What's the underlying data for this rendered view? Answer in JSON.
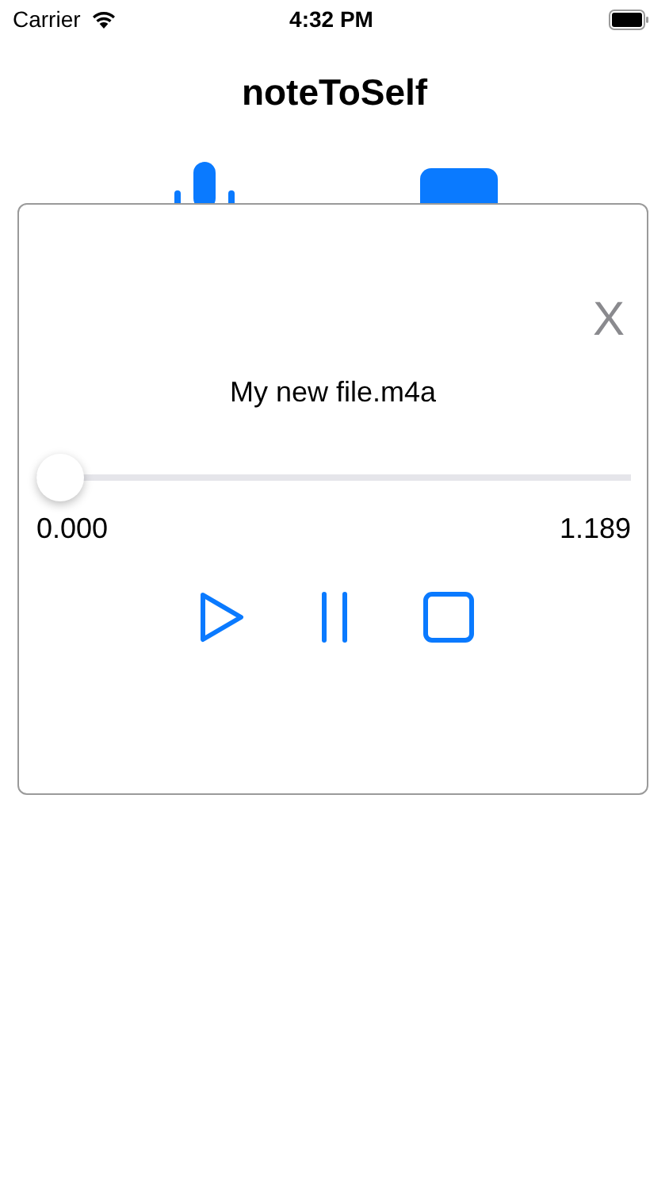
{
  "status_bar": {
    "carrier": "Carrier",
    "time": "4:32 PM"
  },
  "title": "noteToSelf",
  "player": {
    "close": "X",
    "file_name": "My new file.m4a",
    "slider": {
      "level": 0
    },
    "elapsed": "0.000",
    "duration": "1.189"
  }
}
